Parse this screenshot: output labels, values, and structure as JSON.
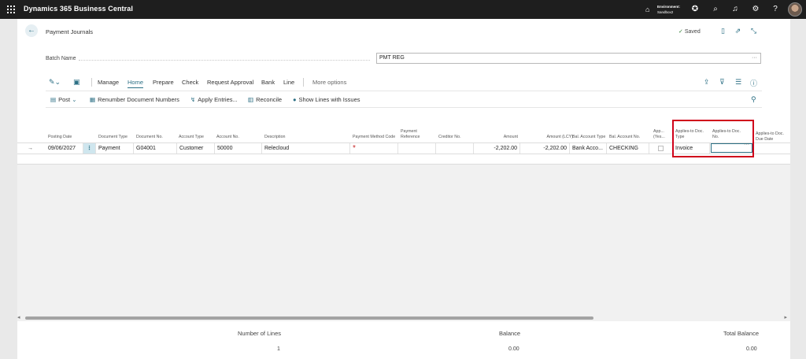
{
  "app": {
    "title": "Dynamics 365 Business Central"
  },
  "environment": {
    "label": "Environment:",
    "name": "Sandbox2"
  },
  "page": {
    "title": "Payment Journals",
    "saved_label": "Saved"
  },
  "batch": {
    "label": "Batch Name",
    "value": "PMT REG",
    "more": "···"
  },
  "actions": {
    "manage": "Manage",
    "home": "Home",
    "prepare": "Prepare",
    "check": "Check",
    "request_approval": "Request Approval",
    "bank": "Bank",
    "line": "Line",
    "more_options": "More options"
  },
  "subactions": {
    "post": "Post",
    "renumber": "Renumber Document Numbers",
    "apply_entries": "Apply Entries...",
    "reconcile": "Reconcile",
    "show_lines": "Show Lines with Issues"
  },
  "columns": {
    "posting_date": "Posting Date",
    "document_type": "Document Type",
    "document_no": "Document No.",
    "account_type": "Account Type",
    "account_no": "Account No.",
    "description": "Description",
    "payment_method_code": "Payment Method Code",
    "payment_reference": "Payment Reference",
    "creditor_no": "Creditor No.",
    "amount": "Amount",
    "amount_lcy": "Amount (LCY)",
    "bal_account_type": "Bal. Account Type",
    "bal_account_no": "Bal. Account No.",
    "app_yes": "App... (Yes...",
    "applies_to_doc_type": "Applies-to Doc. Type",
    "applies_to_doc_no": "Applies-to Doc. No.",
    "applies_to_doc_due_date": "Applies-to Doc. Due Date"
  },
  "row": {
    "arrow": "→",
    "menu": "⋮",
    "posting_date": "09/06/2027",
    "document_type": "Payment",
    "document_no": "G04001",
    "account_type": "Customer",
    "account_no": "50000",
    "description": "Relecloud",
    "payment_method_code": "*",
    "amount": "-2,202.00",
    "amount_lcy": "-2,202.00",
    "bal_account_type": "Bank Acco...",
    "bal_account_no": "CHECKING",
    "applies_to_doc_type": "Invoice",
    "applies_to_doc_no_more": "···"
  },
  "footer": {
    "number_of_lines_label": "Number of Lines",
    "number_of_lines": "1",
    "balance_label": "Balance",
    "balance": "0.00",
    "total_balance_label": "Total Balance",
    "total_balance": "0.00"
  },
  "colors": {
    "topbar": "#1e1e1e",
    "accent": "#2b6f84",
    "highlight": "#d0021b"
  }
}
